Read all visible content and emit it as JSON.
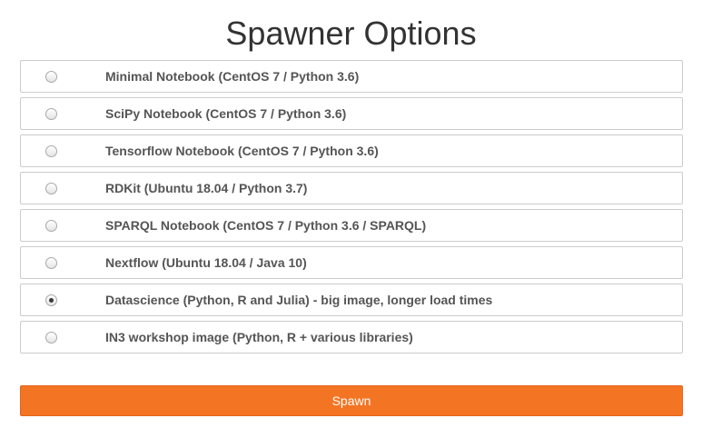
{
  "header": {
    "title": "Spawner Options"
  },
  "profiles": {
    "selected_index": 6,
    "items": [
      {
        "label": "Minimal Notebook (CentOS 7 / Python 3.6)",
        "checked": false
      },
      {
        "label": "SciPy Notebook (CentOS 7 / Python 3.6)",
        "checked": false
      },
      {
        "label": "Tensorflow Notebook (CentOS 7 / Python 3.6)",
        "checked": false
      },
      {
        "label": "RDKit (Ubuntu 18.04 / Python 3.7)",
        "checked": false
      },
      {
        "label": "SPARQL Notebook (CentOS 7 / Python 3.6 / SPARQL)",
        "checked": false
      },
      {
        "label": "Nextflow (Ubuntu 18.04 / Java 10)",
        "checked": false
      },
      {
        "label": "Datascience (Python, R and Julia) - big image, longer load times",
        "checked": true
      },
      {
        "label": "IN3 workshop image (Python, R + various libraries)",
        "checked": false
      }
    ]
  },
  "actions": {
    "spawn_label": "Spawn"
  },
  "colors": {
    "accent": "#f37524",
    "text": "#555555",
    "title": "#333333",
    "border": "#cccccc"
  }
}
